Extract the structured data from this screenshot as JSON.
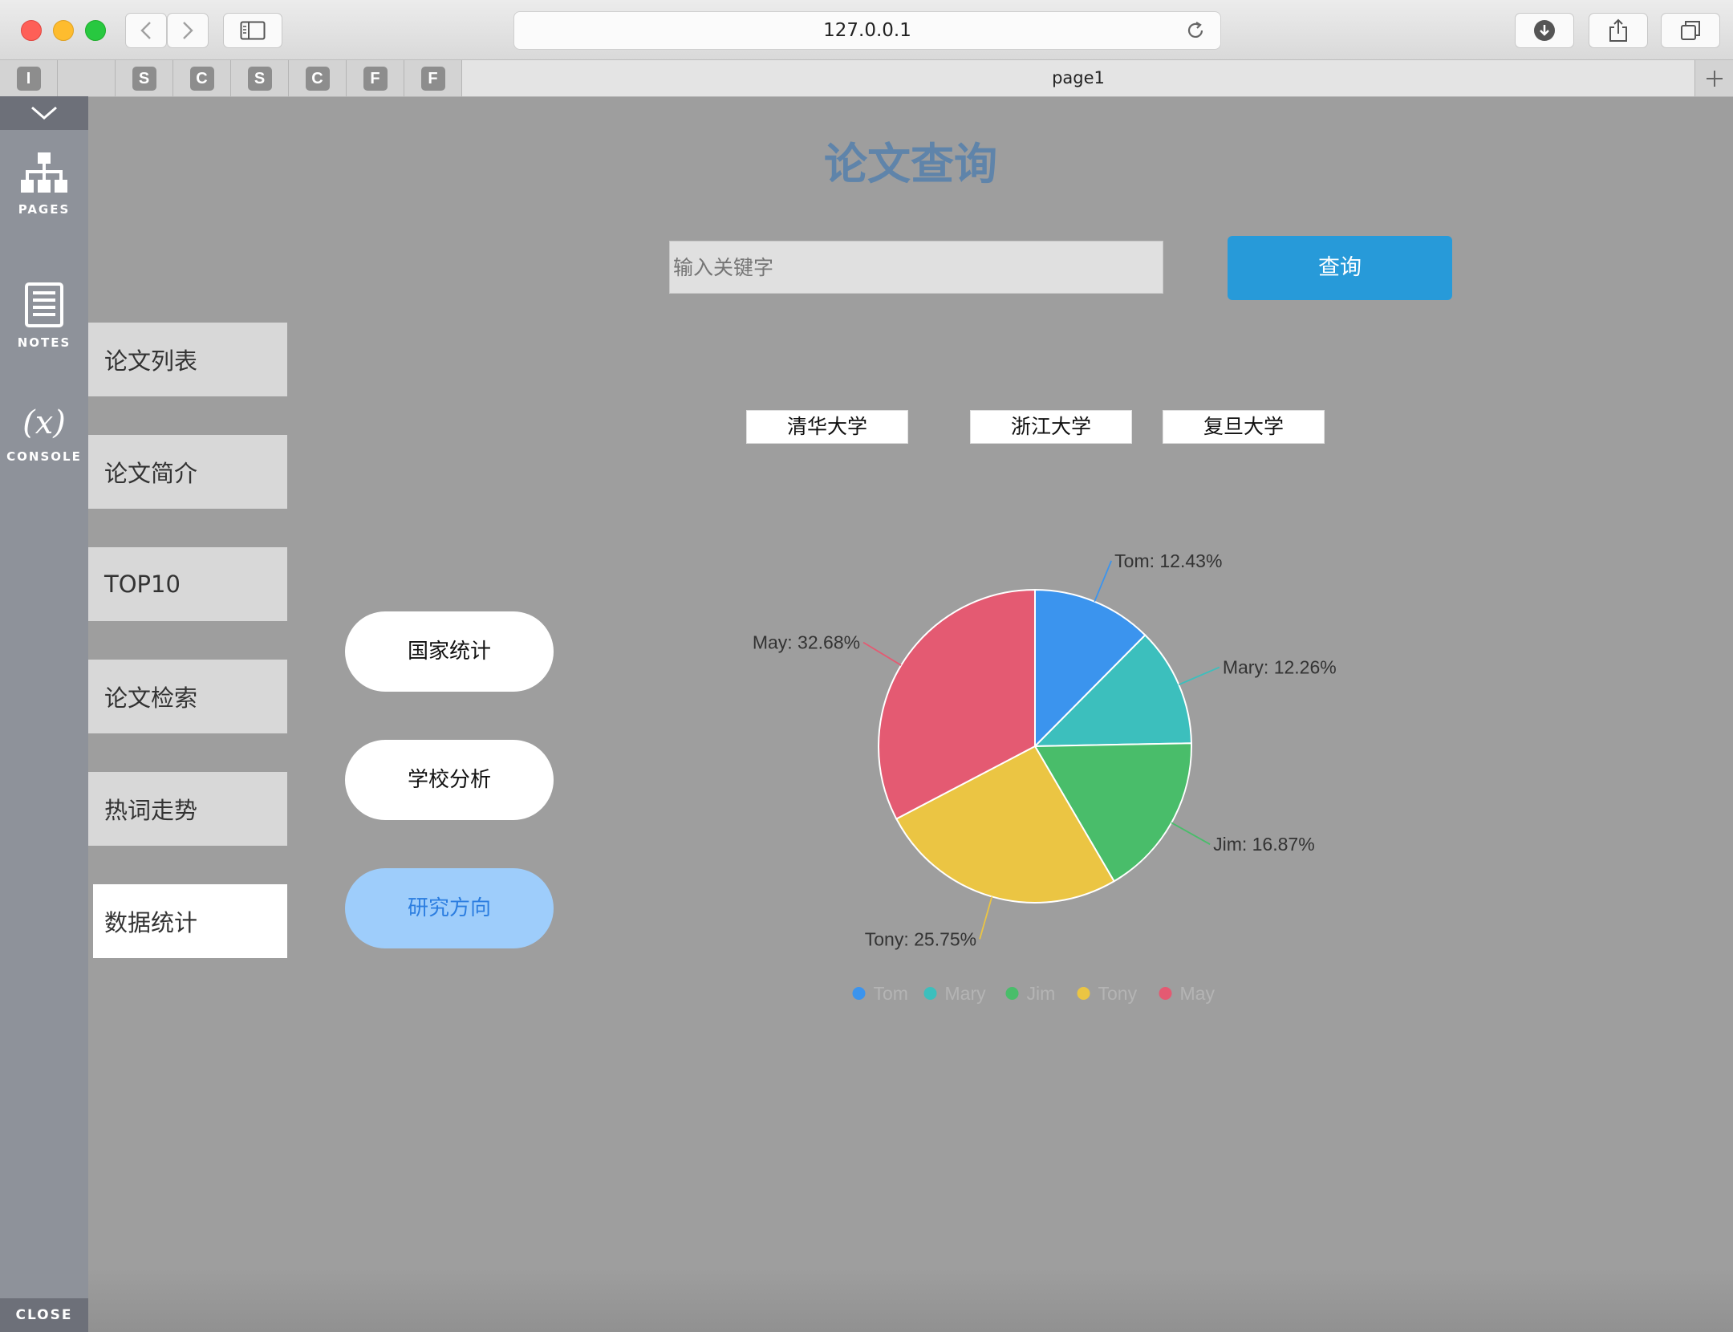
{
  "browser": {
    "url": "127.0.0.1",
    "tab_title": "page1",
    "pinned_tabs": [
      "I",
      "",
      "S",
      "C",
      "S",
      "C",
      "F",
      "F"
    ]
  },
  "sidebar": {
    "items": [
      {
        "label": "PAGES",
        "icon": "sitemap-icon"
      },
      {
        "label": "NOTES",
        "icon": "notes-icon"
      },
      {
        "label": "CONSOLE",
        "icon": "variable-icon"
      }
    ],
    "console_symbol": "(x)",
    "close_label": "CLOSE"
  },
  "nav": {
    "items": [
      "论文列表",
      "论文简介",
      "TOP10",
      "论文检索",
      "热词走势",
      "数据统计"
    ],
    "active_index": 5
  },
  "header": {
    "title": "论文查询"
  },
  "search": {
    "placeholder": "输入关键字",
    "button_label": "查询"
  },
  "schools": [
    "清华大学",
    "浙江大学",
    "复旦大学"
  ],
  "stats_buttons": [
    "国家统计",
    "学校分析",
    "研究方向"
  ],
  "stats_active_index": 2,
  "colors": {
    "accent": "#279ad9",
    "title": "#5f84aa",
    "pill_active_bg": "#9ecdfb",
    "pill_active_text": "#2b7de0"
  },
  "chart_data": {
    "type": "pie",
    "series": [
      {
        "name": "Tom",
        "value": 12.43,
        "label": "Tom: 12.43%",
        "color": "#3b94ee"
      },
      {
        "name": "Mary",
        "value": 12.26,
        "label": "Mary: 12.26%",
        "color": "#3cbfbd"
      },
      {
        "name": "Jim",
        "value": 16.87,
        "label": "Jim: 16.87%",
        "color": "#49bd6a"
      },
      {
        "name": "Tony",
        "value": 25.75,
        "label": "Tony: 25.75%",
        "color": "#ebc543"
      },
      {
        "name": "May",
        "value": 32.68,
        "label": "May: 32.68%",
        "color": "#e45a72"
      }
    ],
    "legend": "bottom",
    "title": ""
  }
}
